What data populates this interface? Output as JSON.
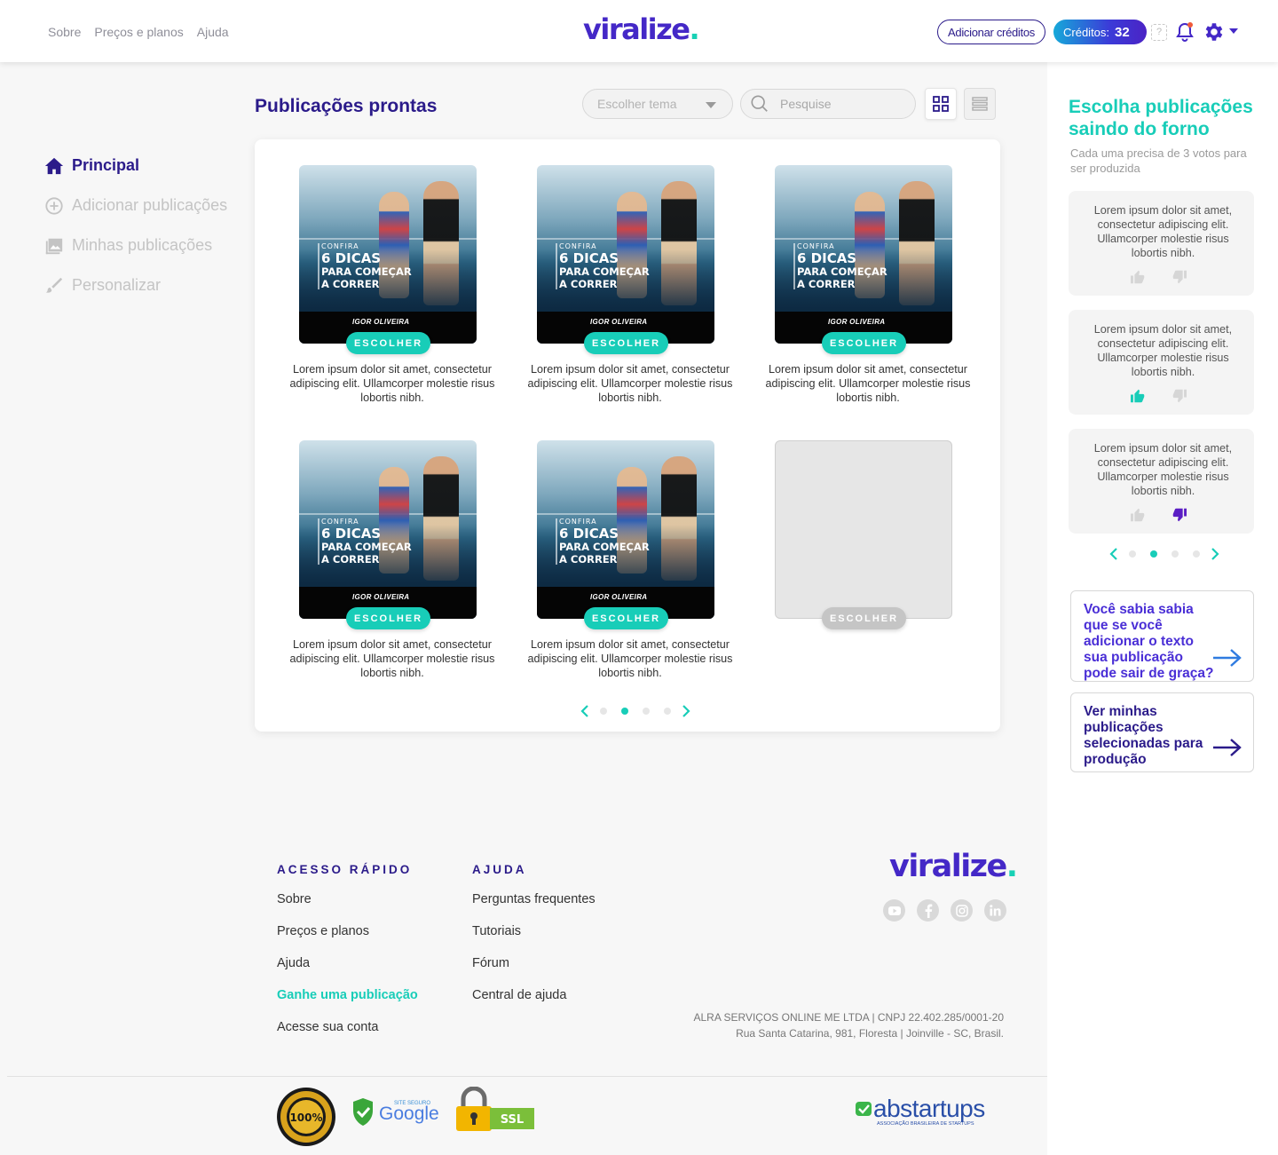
{
  "header": {
    "nav": [
      "Sobre",
      "Preços e planos",
      "Ajuda"
    ],
    "logo": "viralize",
    "logo_dot": ".",
    "add_credits": "Adicionar créditos",
    "credits_label": "Créditos:",
    "credits_value": "32",
    "help": "?"
  },
  "sidebar": {
    "items": [
      {
        "label": "Principal",
        "icon": "home-icon",
        "active": true
      },
      {
        "label": "Adicionar publicações",
        "icon": "plus-circle-icon",
        "active": false
      },
      {
        "label": "Minhas publicações",
        "icon": "image-icon",
        "active": false
      },
      {
        "label": "Personalizar",
        "icon": "brush-icon",
        "active": false
      }
    ]
  },
  "main": {
    "title": "Publicações prontas",
    "theme_placeholder": "Escolher tema",
    "search_placeholder": "Pesquise",
    "choose_label": "ESCOLHER",
    "post_image": {
      "line1": "CONFIRA",
      "line2": "6 DICAS",
      "line3": "PARA COMEÇAR",
      "line4": "A CORRER",
      "brand": "IGOR OLIVEIRA"
    },
    "cards": [
      {
        "desc": "Lorem ipsum dolor sit amet, consectetur adipiscing elit. Ullamcorper molestie risus lobortis nibh."
      },
      {
        "desc": "Lorem ipsum dolor sit amet, consectetur adipiscing elit. Ullamcorper molestie risus lobortis nibh."
      },
      {
        "desc": "Lorem ipsum dolor sit amet, consectetur adipiscing elit. Ullamcorper molestie risus lobortis nibh."
      },
      {
        "desc": "Lorem ipsum dolor sit amet, consectetur adipiscing elit. Ullamcorper molestie risus lobortis nibh."
      },
      {
        "desc": "Lorem ipsum dolor sit amet, consectetur adipiscing elit. Ullamcorper molestie risus lobortis nibh."
      }
    ],
    "pager_active": 2,
    "pager_count": 4
  },
  "right": {
    "title": "Escolha publicações saindo do forno",
    "subtitle": "Cada uma precisa de 3 votos para ser produzida",
    "votes": [
      {
        "text": "Lorem ipsum dolor sit amet, consectetur adipiscing elit. Ullamcorper molestie risus lobortis nibh.",
        "state": "none"
      },
      {
        "text": "Lorem ipsum dolor sit amet, consectetur adipiscing elit. Ullamcorper molestie risus lobortis nibh.",
        "state": "up"
      },
      {
        "text": "Lorem ipsum dolor sit amet, consectetur adipiscing elit. Ullamcorper molestie risus lobortis nibh.",
        "state": "down"
      }
    ],
    "pager_active": 2,
    "pager_count": 4,
    "info1": "Você sabia sabia que se você adicionar o texto sua publicação pode sair de graça?",
    "info2": "Ver minhas publicações selecionadas para produção"
  },
  "footer": {
    "quick_title": "ACESSO RÁPIDO",
    "quick_links": [
      {
        "label": "Sobre",
        "highlight": false
      },
      {
        "label": "Preços e planos",
        "highlight": false
      },
      {
        "label": "Ajuda",
        "highlight": false
      },
      {
        "label": "Ganhe uma publicação",
        "highlight": true
      },
      {
        "label": "Acesse sua conta",
        "highlight": false
      }
    ],
    "help_title": "AJUDA",
    "help_links": [
      "Perguntas frequentes",
      "Tutoriais",
      "Fórum",
      "Central de ajuda"
    ],
    "logo": "viralize",
    "logo_dot": ".",
    "social": [
      "youtube-icon",
      "facebook-icon",
      "instagram-icon",
      "linkedin-icon"
    ],
    "legal1": "ALRA SERVIÇOS ONLINE ME LTDA | CNPJ 22.402.285/0001-20",
    "legal2": "Rua Santa Catarina, 981, Floresta | Joinville - SC, Brasil.",
    "seal_quality": "100%",
    "seal_google_small": "SITE SEGURO",
    "seal_google": "Google",
    "seal_ssl": "SSL",
    "abstartups": "abstartups",
    "abstartups_sub": "ASSOCIAÇÃO BRASILEIRA DE STARTUPS"
  },
  "colors": {
    "brand_purple": "#2b1b8a",
    "logo_purple": "#4428c7",
    "teal": "#18cdb8"
  }
}
